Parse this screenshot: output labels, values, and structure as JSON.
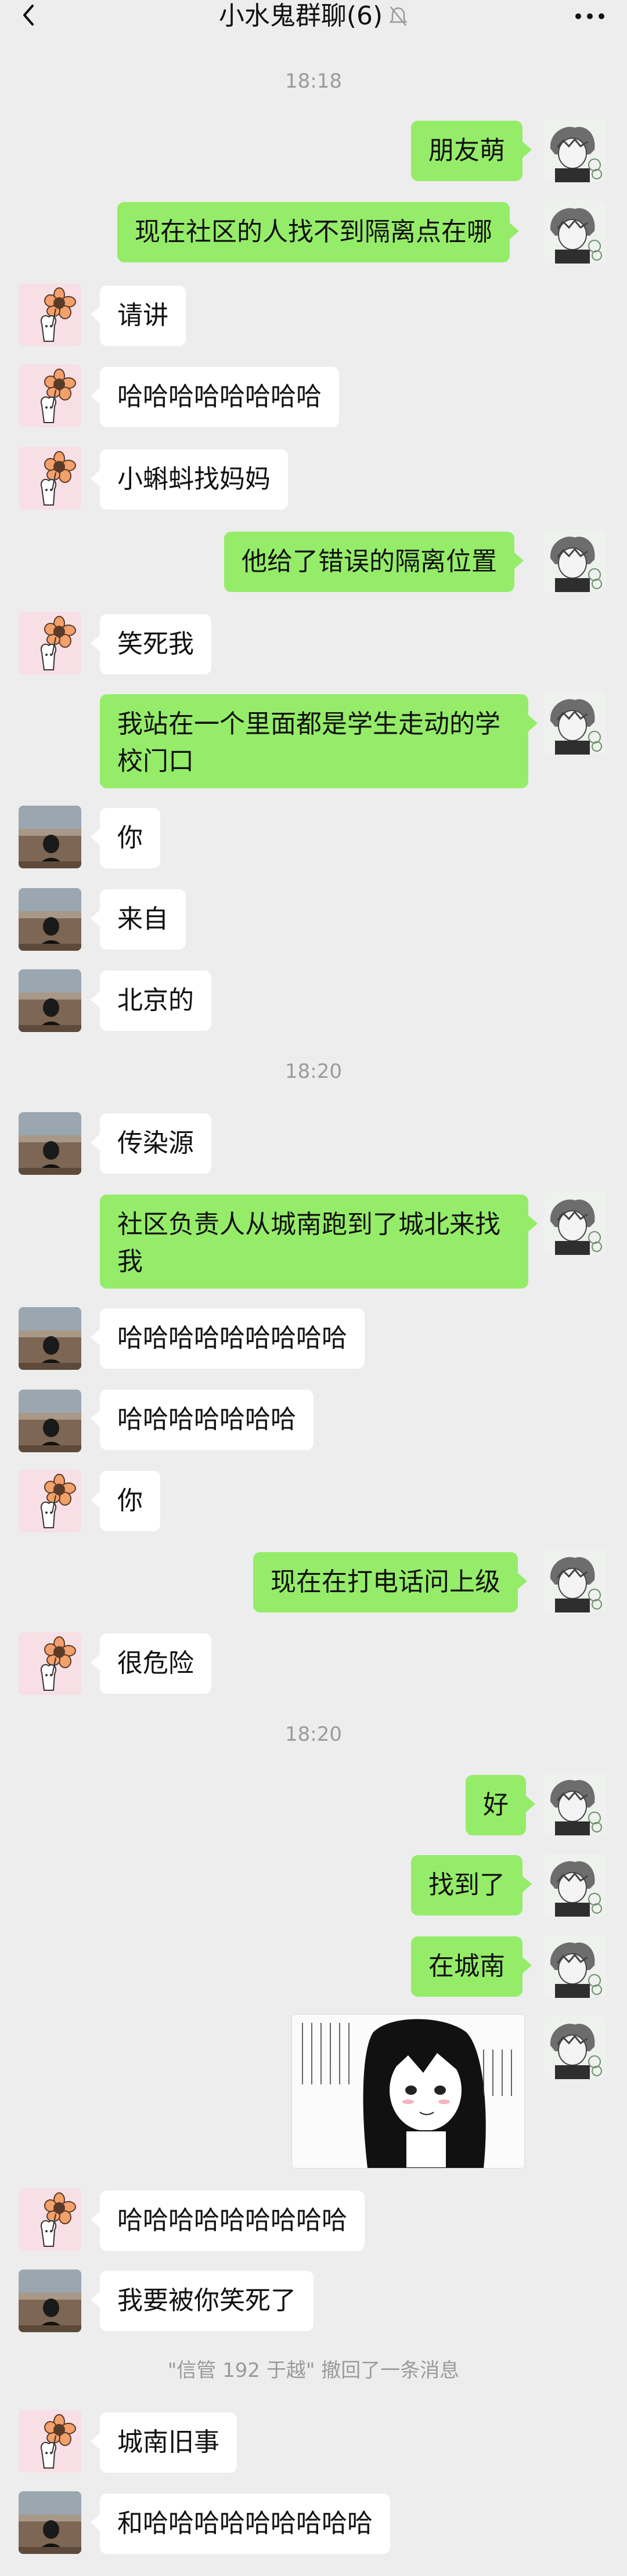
{
  "header": {
    "title": "小水鬼群聊(6)",
    "back_icon": "chevron-left-icon",
    "mute_icon": "mute-bell-icon",
    "more_icon": "more-dots-icon"
  },
  "timestamps": [
    "18:18",
    "18:20",
    "18:20"
  ],
  "system": {
    "recall_text": "\"信管 192 于越\" 撤回了一条消息"
  },
  "messages": [
    {
      "side": "right",
      "avatar": "anime-avatar",
      "text": "朋友萌"
    },
    {
      "side": "right",
      "avatar": "anime-avatar",
      "text": "现在社区的人找不到隔离点在哪"
    },
    {
      "side": "left",
      "avatar": "flower-avatar",
      "text": "请讲"
    },
    {
      "side": "left",
      "avatar": "flower-avatar",
      "text": "哈哈哈哈哈哈哈哈"
    },
    {
      "side": "left",
      "avatar": "flower-avatar",
      "text": "小蝌蚪找妈妈"
    },
    {
      "side": "right",
      "avatar": "anime-avatar",
      "text": "他给了错误的隔离位置"
    },
    {
      "side": "left",
      "avatar": "flower-avatar",
      "text": "笑死我"
    },
    {
      "side": "right",
      "avatar": "anime-avatar",
      "text": "我站在一个里面都是学生走动的学校门口"
    },
    {
      "side": "left",
      "avatar": "photo-avatar",
      "text": "你"
    },
    {
      "side": "left",
      "avatar": "photo-avatar",
      "text": "来自"
    },
    {
      "side": "left",
      "avatar": "photo-avatar",
      "text": "北京的"
    },
    {
      "side": "left",
      "avatar": "photo-avatar",
      "text": "传染源"
    },
    {
      "side": "right",
      "avatar": "anime-avatar",
      "text": "社区负责人从城南跑到了城北来找我"
    },
    {
      "side": "left",
      "avatar": "photo-avatar",
      "text": "哈哈哈哈哈哈哈哈哈"
    },
    {
      "side": "left",
      "avatar": "photo-avatar",
      "text": "哈哈哈哈哈哈哈"
    },
    {
      "side": "left",
      "avatar": "flower-avatar",
      "text": "你"
    },
    {
      "side": "right",
      "avatar": "anime-avatar",
      "text": "现在在打电话问上级"
    },
    {
      "side": "left",
      "avatar": "flower-avatar",
      "text": "很危险"
    },
    {
      "side": "right",
      "avatar": "anime-avatar",
      "text": "好"
    },
    {
      "side": "right",
      "avatar": "anime-avatar",
      "text": "找到了"
    },
    {
      "side": "right",
      "avatar": "anime-avatar",
      "text": "在城南"
    },
    {
      "side": "right",
      "avatar": "anime-avatar",
      "sticker": "anime-sticker-image",
      "text": ""
    },
    {
      "side": "left",
      "avatar": "flower-avatar",
      "text": "哈哈哈哈哈哈哈哈哈"
    },
    {
      "side": "left",
      "avatar": "photo-avatar",
      "text": "我要被你笑死了"
    },
    {
      "side": "left",
      "avatar": "flower-avatar",
      "text": "城南旧事"
    },
    {
      "side": "left",
      "avatar": "photo-avatar",
      "text": "和哈哈哈哈哈哈哈哈哈"
    }
  ],
  "colors": {
    "background": "#ededed",
    "right_bubble": "#95ec69",
    "left_bubble": "#ffffff",
    "timestamp_text": "#9b9b9b"
  }
}
